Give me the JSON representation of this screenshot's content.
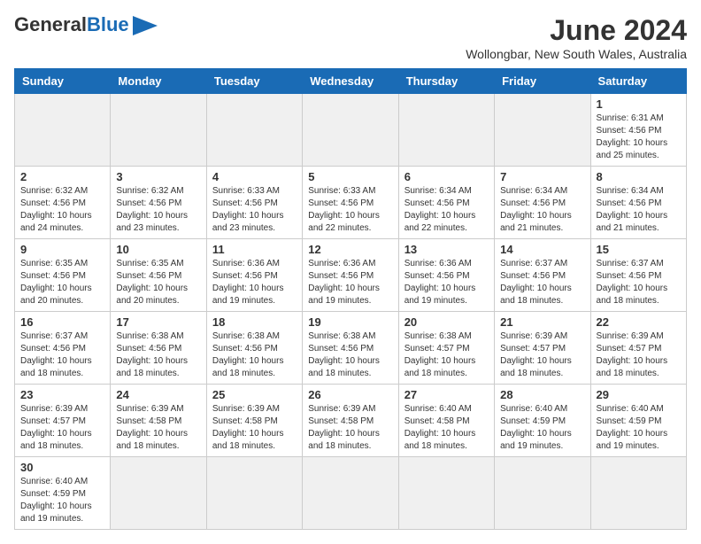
{
  "header": {
    "logo_general": "General",
    "logo_blue": "Blue",
    "month": "June 2024",
    "location": "Wollongbar, New South Wales, Australia"
  },
  "days_of_week": [
    "Sunday",
    "Monday",
    "Tuesday",
    "Wednesday",
    "Thursday",
    "Friday",
    "Saturday"
  ],
  "weeks": [
    [
      {
        "day": "",
        "info": "",
        "empty": true
      },
      {
        "day": "",
        "info": "",
        "empty": true
      },
      {
        "day": "",
        "info": "",
        "empty": true
      },
      {
        "day": "",
        "info": "",
        "empty": true
      },
      {
        "day": "",
        "info": "",
        "empty": true
      },
      {
        "day": "",
        "info": "",
        "empty": true
      },
      {
        "day": "1",
        "info": "Sunrise: 6:31 AM\nSunset: 4:56 PM\nDaylight: 10 hours\nand 25 minutes."
      }
    ],
    [
      {
        "day": "2",
        "info": "Sunrise: 6:32 AM\nSunset: 4:56 PM\nDaylight: 10 hours\nand 24 minutes."
      },
      {
        "day": "3",
        "info": "Sunrise: 6:32 AM\nSunset: 4:56 PM\nDaylight: 10 hours\nand 23 minutes."
      },
      {
        "day": "4",
        "info": "Sunrise: 6:33 AM\nSunset: 4:56 PM\nDaylight: 10 hours\nand 23 minutes."
      },
      {
        "day": "5",
        "info": "Sunrise: 6:33 AM\nSunset: 4:56 PM\nDaylight: 10 hours\nand 22 minutes."
      },
      {
        "day": "6",
        "info": "Sunrise: 6:34 AM\nSunset: 4:56 PM\nDaylight: 10 hours\nand 22 minutes."
      },
      {
        "day": "7",
        "info": "Sunrise: 6:34 AM\nSunset: 4:56 PM\nDaylight: 10 hours\nand 21 minutes."
      },
      {
        "day": "8",
        "info": "Sunrise: 6:34 AM\nSunset: 4:56 PM\nDaylight: 10 hours\nand 21 minutes."
      }
    ],
    [
      {
        "day": "9",
        "info": "Sunrise: 6:35 AM\nSunset: 4:56 PM\nDaylight: 10 hours\nand 20 minutes."
      },
      {
        "day": "10",
        "info": "Sunrise: 6:35 AM\nSunset: 4:56 PM\nDaylight: 10 hours\nand 20 minutes."
      },
      {
        "day": "11",
        "info": "Sunrise: 6:36 AM\nSunset: 4:56 PM\nDaylight: 10 hours\nand 19 minutes."
      },
      {
        "day": "12",
        "info": "Sunrise: 6:36 AM\nSunset: 4:56 PM\nDaylight: 10 hours\nand 19 minutes."
      },
      {
        "day": "13",
        "info": "Sunrise: 6:36 AM\nSunset: 4:56 PM\nDaylight: 10 hours\nand 19 minutes."
      },
      {
        "day": "14",
        "info": "Sunrise: 6:37 AM\nSunset: 4:56 PM\nDaylight: 10 hours\nand 18 minutes."
      },
      {
        "day": "15",
        "info": "Sunrise: 6:37 AM\nSunset: 4:56 PM\nDaylight: 10 hours\nand 18 minutes."
      }
    ],
    [
      {
        "day": "16",
        "info": "Sunrise: 6:37 AM\nSunset: 4:56 PM\nDaylight: 10 hours\nand 18 minutes."
      },
      {
        "day": "17",
        "info": "Sunrise: 6:38 AM\nSunset: 4:56 PM\nDaylight: 10 hours\nand 18 minutes."
      },
      {
        "day": "18",
        "info": "Sunrise: 6:38 AM\nSunset: 4:56 PM\nDaylight: 10 hours\nand 18 minutes."
      },
      {
        "day": "19",
        "info": "Sunrise: 6:38 AM\nSunset: 4:56 PM\nDaylight: 10 hours\nand 18 minutes."
      },
      {
        "day": "20",
        "info": "Sunrise: 6:38 AM\nSunset: 4:57 PM\nDaylight: 10 hours\nand 18 minutes."
      },
      {
        "day": "21",
        "info": "Sunrise: 6:39 AM\nSunset: 4:57 PM\nDaylight: 10 hours\nand 18 minutes."
      },
      {
        "day": "22",
        "info": "Sunrise: 6:39 AM\nSunset: 4:57 PM\nDaylight: 10 hours\nand 18 minutes."
      }
    ],
    [
      {
        "day": "23",
        "info": "Sunrise: 6:39 AM\nSunset: 4:57 PM\nDaylight: 10 hours\nand 18 minutes."
      },
      {
        "day": "24",
        "info": "Sunrise: 6:39 AM\nSunset: 4:58 PM\nDaylight: 10 hours\nand 18 minutes."
      },
      {
        "day": "25",
        "info": "Sunrise: 6:39 AM\nSunset: 4:58 PM\nDaylight: 10 hours\nand 18 minutes."
      },
      {
        "day": "26",
        "info": "Sunrise: 6:39 AM\nSunset: 4:58 PM\nDaylight: 10 hours\nand 18 minutes."
      },
      {
        "day": "27",
        "info": "Sunrise: 6:40 AM\nSunset: 4:58 PM\nDaylight: 10 hours\nand 18 minutes."
      },
      {
        "day": "28",
        "info": "Sunrise: 6:40 AM\nSunset: 4:59 PM\nDaylight: 10 hours\nand 19 minutes."
      },
      {
        "day": "29",
        "info": "Sunrise: 6:40 AM\nSunset: 4:59 PM\nDaylight: 10 hours\nand 19 minutes."
      }
    ],
    [
      {
        "day": "30",
        "info": "Sunrise: 6:40 AM\nSunset: 4:59 PM\nDaylight: 10 hours\nand 19 minutes.",
        "last": true
      },
      {
        "day": "",
        "info": "",
        "empty": true,
        "last": true
      },
      {
        "day": "",
        "info": "",
        "empty": true,
        "last": true
      },
      {
        "day": "",
        "info": "",
        "empty": true,
        "last": true
      },
      {
        "day": "",
        "info": "",
        "empty": true,
        "last": true
      },
      {
        "day": "",
        "info": "",
        "empty": true,
        "last": true
      },
      {
        "day": "",
        "info": "",
        "empty": true,
        "last": true
      }
    ]
  ]
}
